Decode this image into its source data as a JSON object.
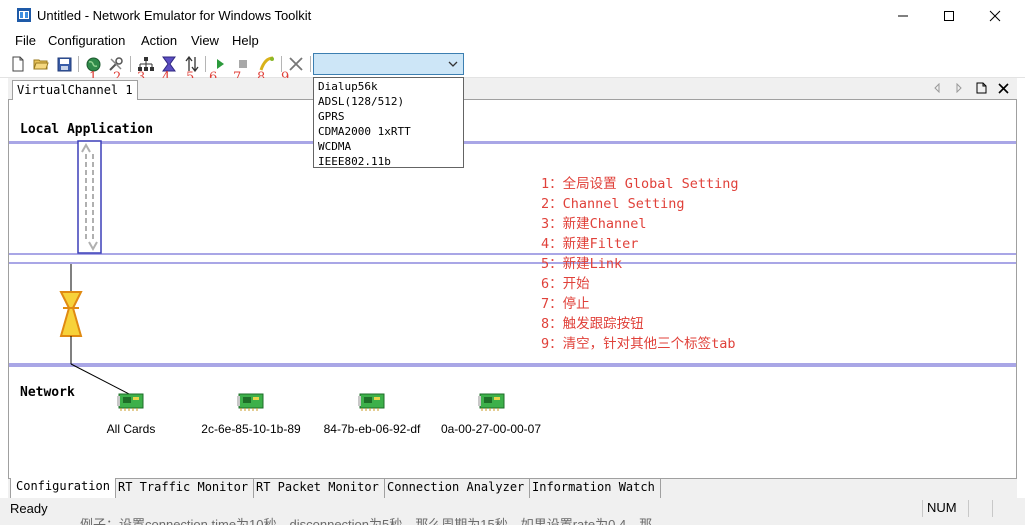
{
  "window": {
    "title": "Untitled - Network Emulator for Windows Toolkit",
    "controls": [
      "minimize",
      "maximize",
      "close"
    ]
  },
  "menu": [
    "File",
    "Configuration",
    "Action",
    "View",
    "Help"
  ],
  "toolbar": {
    "buttons": [
      {
        "icon": "new-file-icon"
      },
      {
        "icon": "open-folder-icon"
      },
      {
        "icon": "save-icon"
      },
      {
        "icon": "globe-icon",
        "num": "1"
      },
      {
        "icon": "tools-icon",
        "num": "2"
      },
      {
        "icon": "network-tree-icon",
        "num": "3"
      },
      {
        "icon": "filter-icon",
        "num": "4"
      },
      {
        "icon": "link-arrows-icon",
        "num": "5"
      },
      {
        "icon": "play-icon",
        "num": "6"
      },
      {
        "icon": "stop-icon",
        "num": "7"
      },
      {
        "icon": "trace-icon",
        "num": "8"
      },
      {
        "icon": "clear-icon",
        "num": "9"
      }
    ],
    "combo_value": "",
    "dropdown_options": [
      "Dialup56k",
      "ADSL(128/512)",
      "GPRS",
      "CDMA2000 1xRTT",
      "WCDMA",
      "IEEE802.11b"
    ]
  },
  "document_tab": "VirtualChannel 1",
  "canvas": {
    "local_label": "Local Application",
    "network_label": "Network",
    "notes": [
      "1：全局设置 Global Setting",
      "2：Channel Setting",
      "3：新建Channel",
      "4：新建Filter",
      "5：新建Link",
      "6：开始",
      "7：停止",
      "8：触发跟踪按钮",
      "9：清空，针对其他三个标签tab"
    ],
    "cards": [
      "All Cards",
      "2c-6e-85-10-1b-89",
      "84-7b-eb-06-92-df",
      "0a-00-27-00-00-07"
    ]
  },
  "bottom_tabs": [
    "Configuration",
    "RT Traffic Monitor",
    "RT Packet Monitor",
    "Connection Analyzer",
    "Information Watch"
  ],
  "status": {
    "text": "Ready",
    "num": "NUM",
    "bleed_text": "例子：设置connection time为10秒，disconnection为5秒，那么周期为15秒，如果设置rate为0.4，那"
  },
  "colors": {
    "annotation_red": "#e0413a",
    "lane_line": "#a9a6e6",
    "combo_bg": "#cde6f7",
    "combo_border": "#3c7fb1"
  }
}
